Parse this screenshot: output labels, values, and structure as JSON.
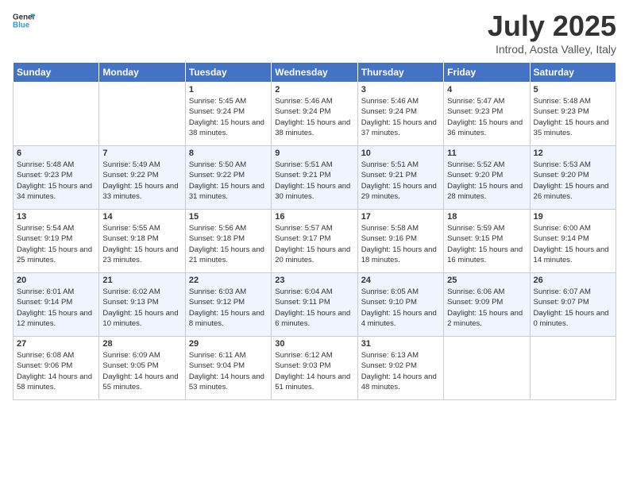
{
  "header": {
    "title": "July 2025",
    "location": "Introd, Aosta Valley, Italy"
  },
  "days": [
    "Sunday",
    "Monday",
    "Tuesday",
    "Wednesday",
    "Thursday",
    "Friday",
    "Saturday"
  ],
  "weeks": [
    [
      {
        "day": "",
        "info": ""
      },
      {
        "day": "",
        "info": ""
      },
      {
        "day": "1",
        "info": "Sunrise: 5:45 AM\nSunset: 9:24 PM\nDaylight: 15 hours and 38 minutes."
      },
      {
        "day": "2",
        "info": "Sunrise: 5:46 AM\nSunset: 9:24 PM\nDaylight: 15 hours and 38 minutes."
      },
      {
        "day": "3",
        "info": "Sunrise: 5:46 AM\nSunset: 9:24 PM\nDaylight: 15 hours and 37 minutes."
      },
      {
        "day": "4",
        "info": "Sunrise: 5:47 AM\nSunset: 9:23 PM\nDaylight: 15 hours and 36 minutes."
      },
      {
        "day": "5",
        "info": "Sunrise: 5:48 AM\nSunset: 9:23 PM\nDaylight: 15 hours and 35 minutes."
      }
    ],
    [
      {
        "day": "6",
        "info": "Sunrise: 5:48 AM\nSunset: 9:23 PM\nDaylight: 15 hours and 34 minutes."
      },
      {
        "day": "7",
        "info": "Sunrise: 5:49 AM\nSunset: 9:22 PM\nDaylight: 15 hours and 33 minutes."
      },
      {
        "day": "8",
        "info": "Sunrise: 5:50 AM\nSunset: 9:22 PM\nDaylight: 15 hours and 31 minutes."
      },
      {
        "day": "9",
        "info": "Sunrise: 5:51 AM\nSunset: 9:21 PM\nDaylight: 15 hours and 30 minutes."
      },
      {
        "day": "10",
        "info": "Sunrise: 5:51 AM\nSunset: 9:21 PM\nDaylight: 15 hours and 29 minutes."
      },
      {
        "day": "11",
        "info": "Sunrise: 5:52 AM\nSunset: 9:20 PM\nDaylight: 15 hours and 28 minutes."
      },
      {
        "day": "12",
        "info": "Sunrise: 5:53 AM\nSunset: 9:20 PM\nDaylight: 15 hours and 26 minutes."
      }
    ],
    [
      {
        "day": "13",
        "info": "Sunrise: 5:54 AM\nSunset: 9:19 PM\nDaylight: 15 hours and 25 minutes."
      },
      {
        "day": "14",
        "info": "Sunrise: 5:55 AM\nSunset: 9:18 PM\nDaylight: 15 hours and 23 minutes."
      },
      {
        "day": "15",
        "info": "Sunrise: 5:56 AM\nSunset: 9:18 PM\nDaylight: 15 hours and 21 minutes."
      },
      {
        "day": "16",
        "info": "Sunrise: 5:57 AM\nSunset: 9:17 PM\nDaylight: 15 hours and 20 minutes."
      },
      {
        "day": "17",
        "info": "Sunrise: 5:58 AM\nSunset: 9:16 PM\nDaylight: 15 hours and 18 minutes."
      },
      {
        "day": "18",
        "info": "Sunrise: 5:59 AM\nSunset: 9:15 PM\nDaylight: 15 hours and 16 minutes."
      },
      {
        "day": "19",
        "info": "Sunrise: 6:00 AM\nSunset: 9:14 PM\nDaylight: 15 hours and 14 minutes."
      }
    ],
    [
      {
        "day": "20",
        "info": "Sunrise: 6:01 AM\nSunset: 9:14 PM\nDaylight: 15 hours and 12 minutes."
      },
      {
        "day": "21",
        "info": "Sunrise: 6:02 AM\nSunset: 9:13 PM\nDaylight: 15 hours and 10 minutes."
      },
      {
        "day": "22",
        "info": "Sunrise: 6:03 AM\nSunset: 9:12 PM\nDaylight: 15 hours and 8 minutes."
      },
      {
        "day": "23",
        "info": "Sunrise: 6:04 AM\nSunset: 9:11 PM\nDaylight: 15 hours and 6 minutes."
      },
      {
        "day": "24",
        "info": "Sunrise: 6:05 AM\nSunset: 9:10 PM\nDaylight: 15 hours and 4 minutes."
      },
      {
        "day": "25",
        "info": "Sunrise: 6:06 AM\nSunset: 9:09 PM\nDaylight: 15 hours and 2 minutes."
      },
      {
        "day": "26",
        "info": "Sunrise: 6:07 AM\nSunset: 9:07 PM\nDaylight: 15 hours and 0 minutes."
      }
    ],
    [
      {
        "day": "27",
        "info": "Sunrise: 6:08 AM\nSunset: 9:06 PM\nDaylight: 14 hours and 58 minutes."
      },
      {
        "day": "28",
        "info": "Sunrise: 6:09 AM\nSunset: 9:05 PM\nDaylight: 14 hours and 55 minutes."
      },
      {
        "day": "29",
        "info": "Sunrise: 6:11 AM\nSunset: 9:04 PM\nDaylight: 14 hours and 53 minutes."
      },
      {
        "day": "30",
        "info": "Sunrise: 6:12 AM\nSunset: 9:03 PM\nDaylight: 14 hours and 51 minutes."
      },
      {
        "day": "31",
        "info": "Sunrise: 6:13 AM\nSunset: 9:02 PM\nDaylight: 14 hours and 48 minutes."
      },
      {
        "day": "",
        "info": ""
      },
      {
        "day": "",
        "info": ""
      }
    ]
  ]
}
